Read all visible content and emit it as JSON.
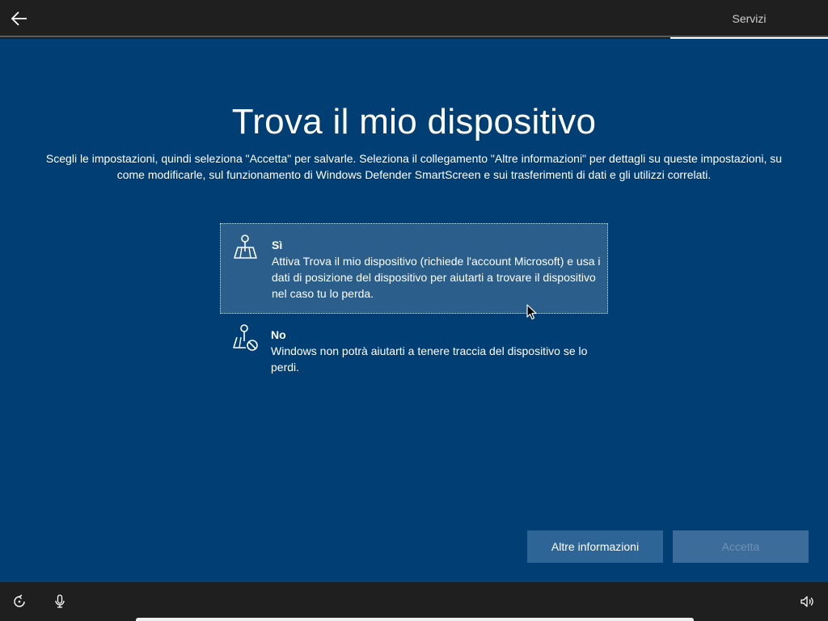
{
  "header": {
    "tab_label": "Servizi"
  },
  "page": {
    "title": "Trova il mio dispositivo",
    "subtitle": "Scegli le impostazioni, quindi seleziona \"Accetta\" per salvarle. Seleziona il collegamento \"Altre informazioni\" per dettagli su queste impostazioni, su come modificarle, sul funzionamento di Windows Defender SmartScreen e sui trasferimenti di dati e gli utilizzi correlati."
  },
  "options": [
    {
      "title": "Sì",
      "description": "Attiva Trova il mio dispositivo (richiede l'account Microsoft) e usa i dati di posizione del dispositivo per aiutarti a trovare il dispositivo nel caso tu lo perda.",
      "icon": "location-map-icon",
      "selected": true
    },
    {
      "title": "No",
      "description": "Windows non potrà aiutarti a tenere traccia del dispositivo se lo perdi.",
      "icon": "location-map-blocked-icon",
      "selected": false
    }
  ],
  "buttons": {
    "more_info": "Altre informazioni",
    "accept": "Accetta"
  },
  "colors": {
    "background": "#003e74",
    "bar": "#1f1f1f",
    "button": "#2e6597"
  },
  "icons": {
    "back": "back-arrow-icon",
    "ease_of_access": "ease-of-access-icon",
    "microphone": "microphone-icon",
    "volume": "volume-icon"
  }
}
